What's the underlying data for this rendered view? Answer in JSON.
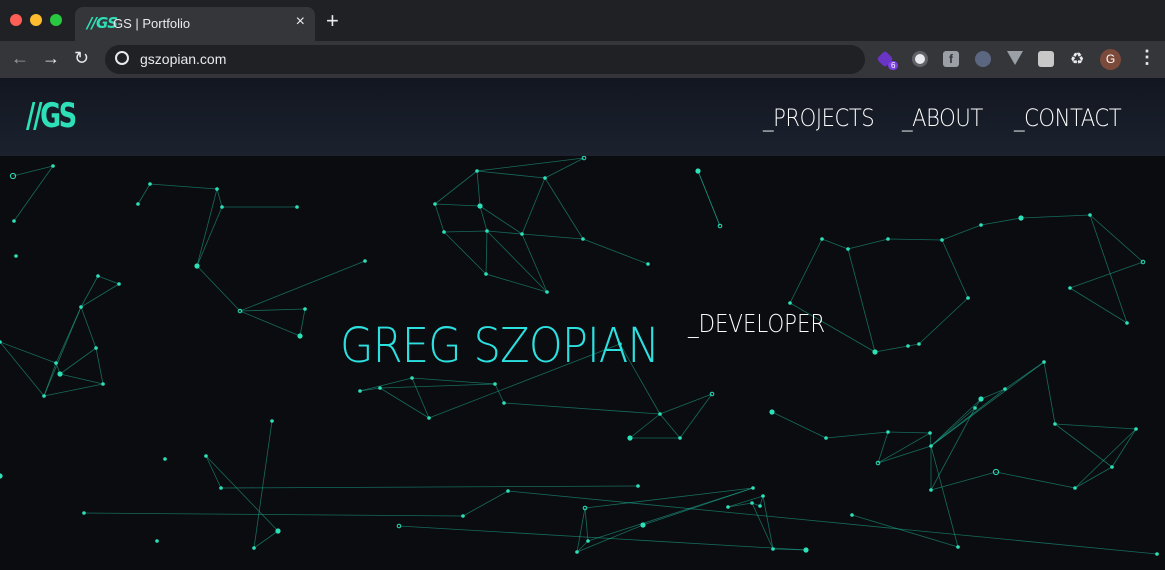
{
  "browser": {
    "tab_title": "GS | Portfolio",
    "tab_favicon": "//GS",
    "tab_close": "×",
    "new_tab": "+",
    "url": "gszopian.com",
    "extension_badge": "6",
    "extension_f": "f",
    "avatar_initial": "G",
    "icons": [
      "back-arrow-icon",
      "forward-arrow-icon",
      "reload-icon",
      "globe-icon",
      "puzzle-icon",
      "menu-dots-icon"
    ]
  },
  "site": {
    "logo": "//GS",
    "nav": [
      "_PROJECTS",
      "_ABOUT",
      "_CONTACT"
    ],
    "hero_name": "GREG SZOPIAN",
    "hero_role": "_DEVELOPER"
  },
  "colors": {
    "accent": "#2de0b8",
    "hero_text": "#2de0e0",
    "background": "#0b0c10"
  }
}
